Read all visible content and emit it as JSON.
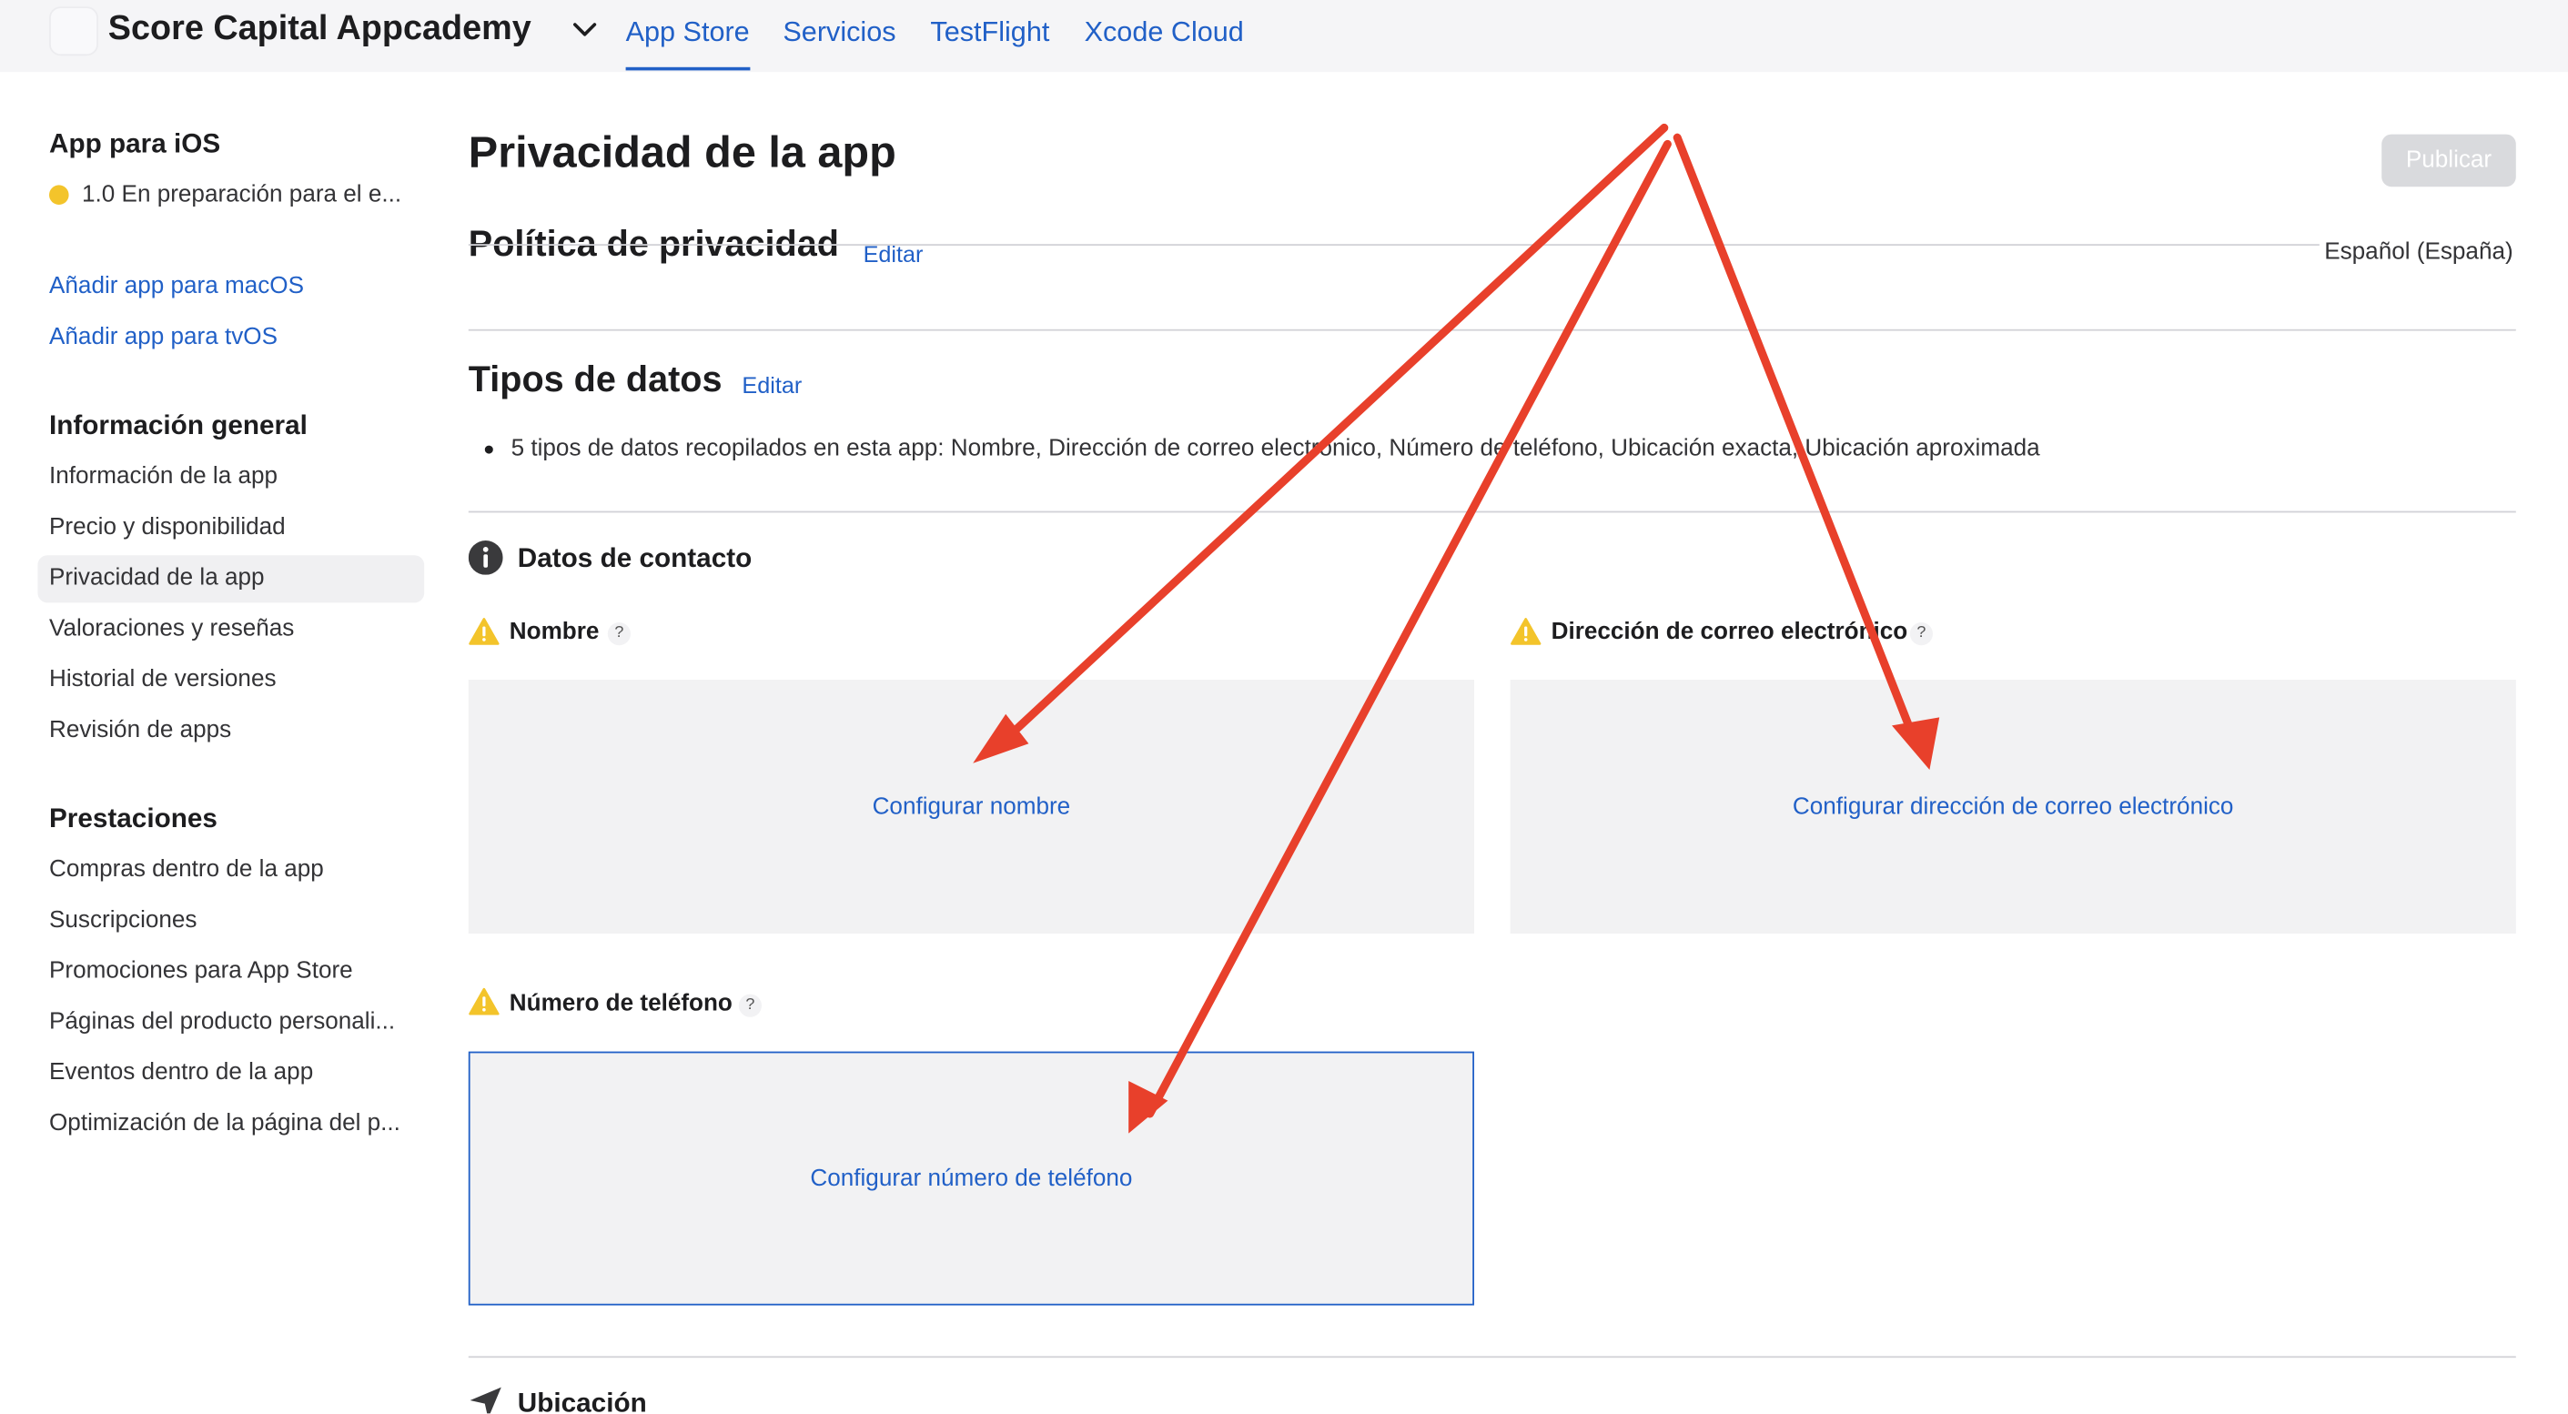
{
  "topbar": {
    "team_name": "Score Capital Appcademy",
    "tabs": [
      {
        "label": "App Store",
        "active": true
      },
      {
        "label": "Servicios",
        "active": false
      },
      {
        "label": "TestFlight",
        "active": false
      },
      {
        "label": "Xcode Cloud",
        "active": false
      }
    ],
    "accent_color": "#2160c7"
  },
  "sidebar": {
    "platform_heading": "App para iOS",
    "version_status": "1.0 En preparación para el e...",
    "status_color": "#f3c42b",
    "add_links": [
      "Añadir app para macOS",
      "Añadir app para tvOS"
    ],
    "general": {
      "heading": "Información general",
      "items": [
        "Información de la app",
        "Precio y disponibilidad",
        "Privacidad de la app",
        "Valoraciones y reseñas",
        "Historial de versiones",
        "Revisión de apps"
      ],
      "selected": "Privacidad de la app"
    },
    "features": {
      "heading": "Prestaciones",
      "items": [
        "Compras dentro de la app",
        "Suscripciones",
        "Promociones para App Store",
        "Páginas del producto personali...",
        "Eventos dentro de la app",
        "Optimización de la página del p..."
      ]
    }
  },
  "main": {
    "title": "Privacidad de la app",
    "publish_label": "Publicar",
    "privacy_policy": {
      "title": "Política de privacidad",
      "edit_label": "Editar",
      "language": "Español (España)"
    },
    "data_types": {
      "title": "Tipos de datos",
      "edit_label": "Editar",
      "summary": "5 tipos de datos recopilados en esta app: Nombre, Dirección de correo electrónico, Número de teléfono, Ubicación exacta, Ubicación aproximada"
    },
    "contact": {
      "title": "Datos de contacto",
      "fields": [
        {
          "label": "Nombre",
          "help": "?",
          "action": "Configurar nombre"
        },
        {
          "label": "Dirección de correo electrónico",
          "help": "?",
          "action": "Configurar dirección de correo electrónico"
        },
        {
          "label": "Número de teléfono",
          "help": "?",
          "action": "Configurar número de teléfono"
        }
      ]
    },
    "location": {
      "title": "Ubicación"
    }
  },
  "annotation": {
    "arrow_color": "#e8402b",
    "arrow_count": 3
  }
}
